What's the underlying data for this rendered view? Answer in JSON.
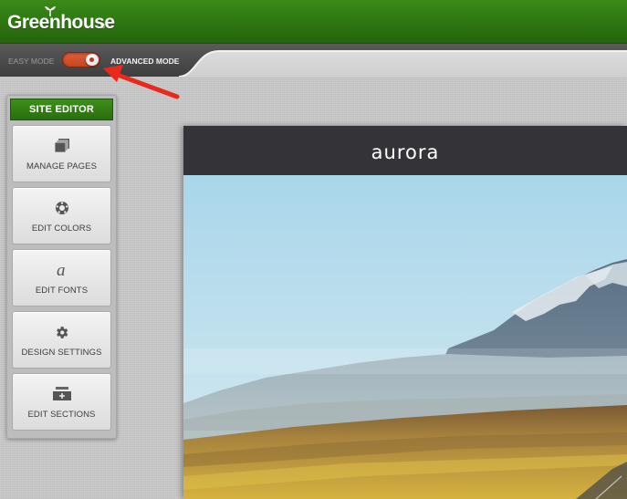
{
  "app": {
    "logo_text": "Greenhouse",
    "registered_mark": "®"
  },
  "mode_switch": {
    "easy_label": "EASY MODE",
    "advanced_label": "ADVANCED MODE",
    "state": "advanced",
    "accent_color": "#d4532c"
  },
  "site_editor": {
    "title": "SITE EDITOR",
    "items": [
      {
        "label": "MANAGE PAGES",
        "icon": "pages-icon"
      },
      {
        "label": "EDIT COLORS",
        "icon": "palette-icon"
      },
      {
        "label": "EDIT FONTS",
        "icon": "font-icon"
      },
      {
        "label": "DESIGN SETTINGS",
        "icon": "gear-icon"
      },
      {
        "label": "EDIT SECTIONS",
        "icon": "sections-icon"
      }
    ]
  },
  "preview": {
    "brand": "aurora"
  },
  "colors": {
    "header_green": "#2c7410",
    "panel_title_green": "#35801a",
    "arrow_red": "#e8291c"
  }
}
